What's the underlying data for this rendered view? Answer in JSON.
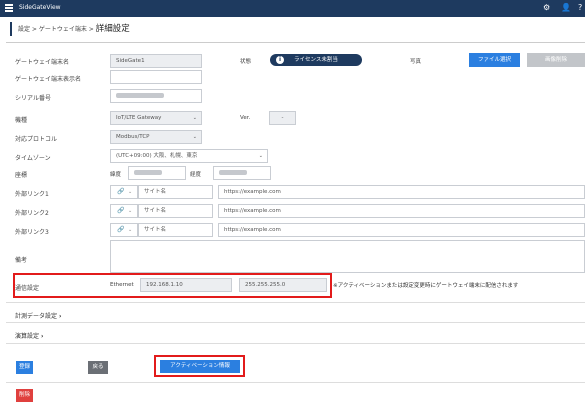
{
  "app": {
    "title": "SideGateView"
  },
  "breadcrumb": {
    "prefix": "設定 > ゲートウェイ端末 > ",
    "current": "詳細設定"
  },
  "form": {
    "gateway_name": {
      "label": "ゲートウェイ端末名",
      "value": "SideGate1"
    },
    "gateway_display_name": {
      "label": "ゲートウェイ端末表示名",
      "value": ""
    },
    "serial": {
      "label": "シリアル番号"
    },
    "model": {
      "label": "機種",
      "value": "IoT/LTE Gateway"
    },
    "protocol": {
      "label": "対応プロトコル",
      "value": "Modbus/TCP"
    },
    "timezone": {
      "label": "タイムゾーン",
      "value": "(UTC+09:00) 大阪、札幌、東京"
    },
    "coords": {
      "label": "座標",
      "lat_label": "緯度",
      "lng_label": "経度"
    },
    "links": [
      {
        "label": "外部リンク1",
        "name_placeholder": "サイト名",
        "url_placeholder": "https://example.com"
      },
      {
        "label": "外部リンク2",
        "name_placeholder": "サイト名",
        "url_placeholder": "https://example.com"
      },
      {
        "label": "外部リンク3",
        "name_placeholder": "サイト名",
        "url_placeholder": "https://example.com"
      }
    ],
    "remarks": {
      "label": "備考"
    },
    "status": {
      "label": "状態",
      "value": "ライセンス未割当"
    },
    "photo": {
      "label": "写真",
      "select_button": "ファイル選択",
      "delete_button": "画像削除"
    },
    "ver": {
      "label": "Ver.",
      "value": "-"
    }
  },
  "comm": {
    "label": "通信設定",
    "interface": "Ethernet",
    "ip": "192.168.1.10",
    "mask": "255.255.255.0",
    "note": "※アクティベーションまたは設定変更時にゲートウェイ端末に配信されます"
  },
  "sections": {
    "measurement": "計測データ設定",
    "alarm": "演算設定"
  },
  "buttons": {
    "register": "登録",
    "back": "戻る",
    "activation": "アクティベーション情報",
    "delete": "削除"
  }
}
